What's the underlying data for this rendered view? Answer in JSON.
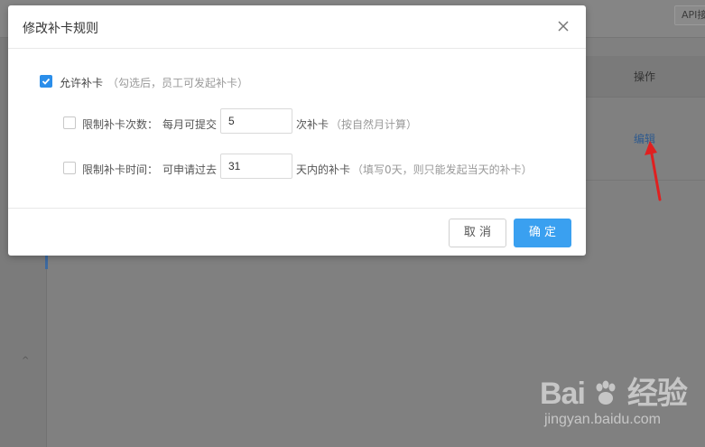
{
  "background": {
    "api_button_label": "API接",
    "table_column_operation": "操作",
    "edit_link": "编辑",
    "nav_caret": "^",
    "watermark": {
      "logo_left": "Bai",
      "logo_right": "经验",
      "url": "jingyan.baidu.com"
    }
  },
  "dialog": {
    "title": "修改补卡规则",
    "allow": {
      "checked": true,
      "label": "允许补卡",
      "hint": "（勾选后，员工可发起补卡）"
    },
    "limit_count": {
      "checked": false,
      "label": "限制补卡次数：",
      "prefix": "每月可提交",
      "value": "5",
      "suffix": "次补卡",
      "hint": "（按自然月计算）"
    },
    "limit_time": {
      "checked": false,
      "label": "限制补卡时间：",
      "prefix": "可申请过去",
      "value": "31",
      "suffix": "天内的补卡",
      "hint": "（填写0天，则只能发起当天的补卡）"
    },
    "cancel_label": "取 消",
    "confirm_label": "确 定"
  }
}
